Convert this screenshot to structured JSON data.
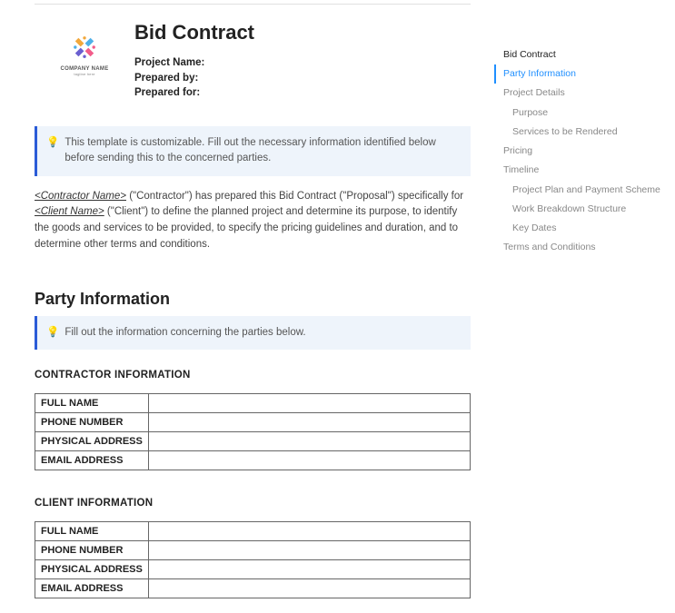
{
  "logo": {
    "company": "COMPANY NAME",
    "tagline": "tagline here"
  },
  "doc_title": "Bid Contract",
  "meta": {
    "project_name_label": "Project Name:",
    "prepared_by_label": "Prepared by:",
    "prepared_for_label": "Prepared for:"
  },
  "callout1": "This template is customizable. Fill out the necessary information identified below before sending this to the concerned parties.",
  "intro": {
    "ph_contractor": "<Contractor Name>",
    "seg1": " (\"Contractor\") has prepared this Bid Contract (\"Proposal\") specifically for ",
    "ph_client": "<Client Name>",
    "seg2": " (\"Client\") to define the planned project and determine its purpose, to identify the goods and services to be provided, to specify the pricing guidelines and duration, and to determine other terms and conditions."
  },
  "section_party_info": "Party Information",
  "callout2": "Fill out the information concerning the parties below.",
  "contractor_heading": "CONTRACTOR INFORMATION",
  "client_heading": "CLIENT INFORMATION",
  "rows": {
    "full_name": "FULL NAME",
    "phone_number": "PHONE NUMBER",
    "physical_address": "PHYSICAL ADDRESS",
    "email_address": "EMAIL ADDRESS"
  },
  "contractor_values": {
    "full_name": "",
    "phone_number": "",
    "physical_address": "",
    "email_address": ""
  },
  "client_values": {
    "full_name": "",
    "phone_number": "",
    "physical_address": "",
    "email_address": ""
  },
  "nav": {
    "n0": "Bid Contract",
    "n1": "Party Information",
    "n2": "Project Details",
    "n2a": "Purpose",
    "n2b": "Services to be Rendered",
    "n3": "Pricing",
    "n4": "Timeline",
    "n4a": "Project Plan and Payment Scheme",
    "n4b": "Work Breakdown Structure",
    "n4c": "Key Dates",
    "n5": "Terms and Conditions"
  }
}
